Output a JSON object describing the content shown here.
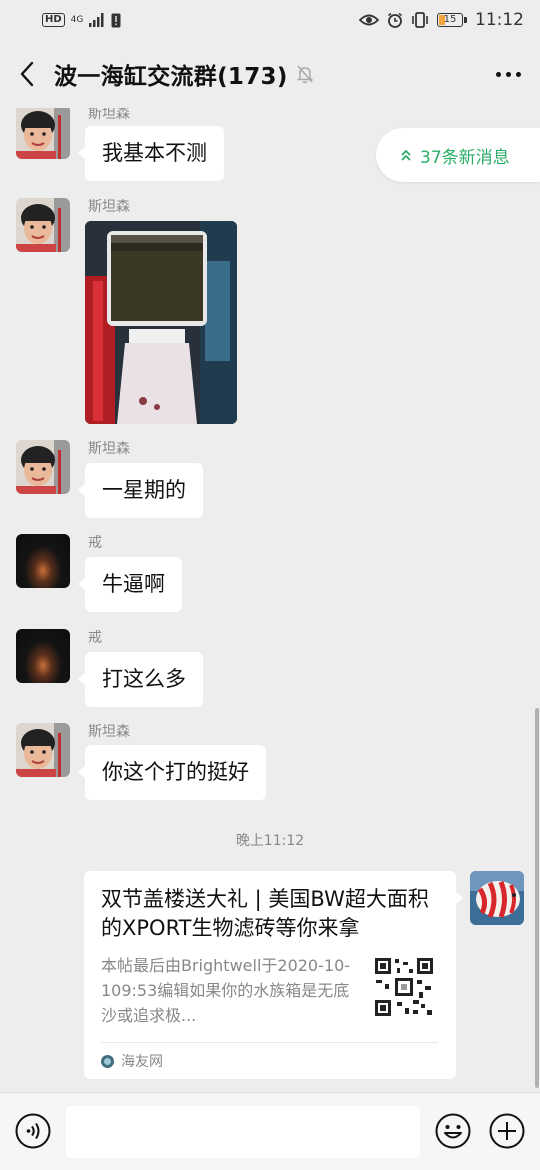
{
  "status_bar": {
    "left": {
      "hd": "HD",
      "network": "4G"
    },
    "battery": "15",
    "time": "11:12"
  },
  "header": {
    "title": "波一海缸交流群(173)",
    "back_icon": "chevron-left-icon",
    "mute_icon": "bell-muted-icon",
    "more_icon": "more-dots-icon"
  },
  "new_messages": {
    "label": "37条新消息",
    "icon": "double-chevron-up-icon"
  },
  "messages": [
    {
      "sender": "斯坦森",
      "type": "text",
      "text": "我基本不测",
      "avatar": "kid-avatar"
    },
    {
      "sender": "斯坦森",
      "type": "image",
      "avatar": "kid-avatar"
    },
    {
      "sender": "斯坦森",
      "type": "text",
      "text": "一星期的",
      "avatar": "kid-avatar"
    },
    {
      "sender": "戒",
      "type": "text",
      "text": "牛逼啊",
      "avatar": "night-avatar"
    },
    {
      "sender": "戒",
      "type": "text",
      "text": "打这么多",
      "avatar": "night-avatar"
    },
    {
      "sender": "斯坦森",
      "type": "text",
      "text": "你这个打的挺好",
      "avatar": "kid-avatar"
    }
  ],
  "timestamp": "晚上11:12",
  "link_card": {
    "title": "双节盖楼送大礼 | 美国BW超大面积的XPORT生物滤砖等你来拿",
    "description": "本帖最后由Brightwell于2020-10-109:53编辑如果你的水族箱是无底沙或追求极...",
    "source": "海友网"
  },
  "input_bar": {
    "voice_icon": "voice-icon",
    "emoji_icon": "emoji-icon",
    "plus_icon": "plus-icon",
    "placeholder": ""
  },
  "colors": {
    "background": "#ededed",
    "accent_green": "#2aae67",
    "bubble": "#ffffff"
  }
}
